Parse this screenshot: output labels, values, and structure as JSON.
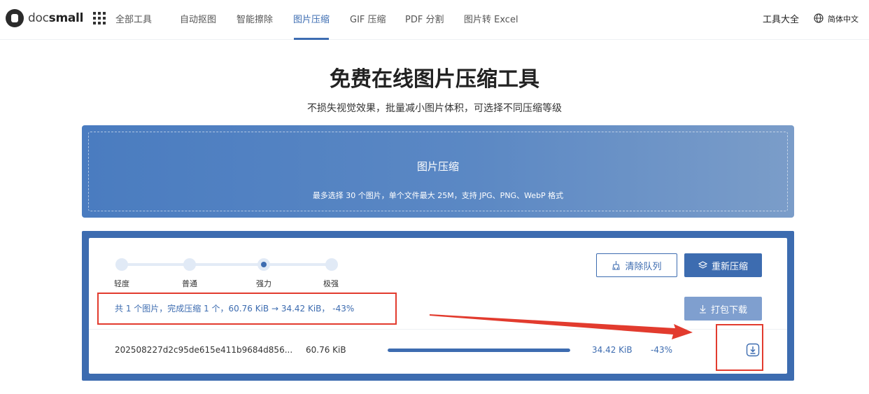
{
  "header": {
    "logo_part1": "doc",
    "logo_part2": "small",
    "nav": [
      {
        "label": "全部工具"
      },
      {
        "label": "自动抠图"
      },
      {
        "label": "智能擦除"
      },
      {
        "label": "图片压缩"
      },
      {
        "label": "GIF 压缩"
      },
      {
        "label": "PDF 分割"
      },
      {
        "label": "图片转 Excel"
      }
    ],
    "active_tab": "图片压缩",
    "tools_link": "工具大全",
    "language": "简体中文"
  },
  "page": {
    "title": "免费在线图片压缩工具",
    "subtitle": "不损失视觉效果，批量减小图片体积，可选择不同压缩等级"
  },
  "upload": {
    "title": "图片压缩",
    "hint": "最多选择 30 个图片，单个文件最大 25M，支持 JPG、PNG、WebP 格式"
  },
  "levels": {
    "options": [
      "轻度",
      "普通",
      "强力",
      "极强"
    ],
    "selected": "强力"
  },
  "actions": {
    "clear_label": "清除队列",
    "recompress_label": "重新压缩",
    "download_all_label": "打包下载"
  },
  "summary": "共 1 个图片，完成压缩 1 个，60.76 KiB → 34.42 KiB， -43%",
  "files": [
    {
      "name": "202508227d2c95de615e411b9684d856...",
      "original_size": "60.76 KiB",
      "progress": 1.0,
      "compressed_size": "34.42 KiB",
      "ratio": "-43%"
    }
  ],
  "colors": {
    "accent": "#3d6cb0",
    "highlight": "#e23b2e"
  }
}
